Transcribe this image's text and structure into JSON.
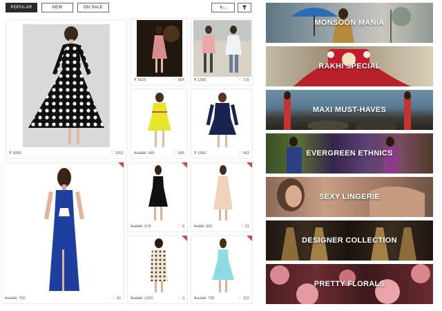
{
  "tabs": [
    {
      "label": "POPULAR"
    },
    {
      "label": "NEW"
    },
    {
      "label": "ON SALE"
    }
  ],
  "toolbar": {
    "sort_icon": "₹↑↓",
    "filter_icon": "filter-icon"
  },
  "products": [
    {
      "price": "₹ 1699",
      "likes": "1261"
    },
    {
      "price": "₹ 1625",
      "likes": "954"
    },
    {
      "price": "₹ 1290",
      "likes": "710"
    },
    {
      "old_price": "₹ 1399",
      "price": "549",
      "likes": "565"
    },
    {
      "price": "₹ 1690",
      "likes": "563"
    },
    {
      "old_price": "₹ 1499",
      "price": "750",
      "likes": "42"
    },
    {
      "old_price": "₹ 1695",
      "price": "678",
      "likes": "6"
    },
    {
      "old_price": "₹ 999",
      "price": "500",
      "likes": "21"
    },
    {
      "old_price": "₹ 1699",
      "price": "1020",
      "likes": "3"
    },
    {
      "old_price": "₹ 1499",
      "price": "750",
      "likes": "122"
    }
  ],
  "banners": [
    {
      "label": "MONSOON MANIA"
    },
    {
      "label": "RAKHI SPECIAL"
    },
    {
      "label": "MAXI MUST-HAVES"
    },
    {
      "label": "EVERGREEN ETHNICS"
    },
    {
      "label": "SEXY LINGERIE"
    },
    {
      "label": "DESIGNER COLLECTION"
    },
    {
      "label": "PRETTY FLORALS"
    }
  ],
  "colors": {
    "accent": "#d9463f",
    "active_tab": "#2a2a2a"
  }
}
